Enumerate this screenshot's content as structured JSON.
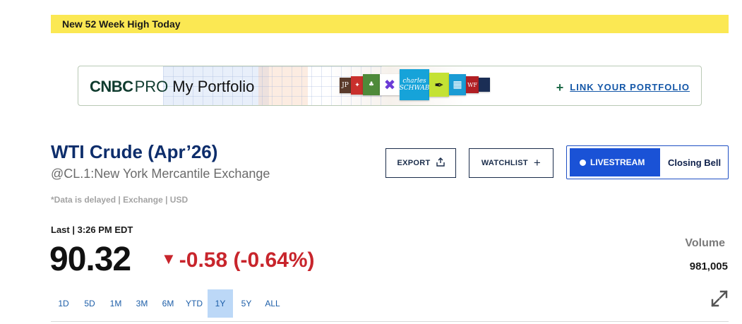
{
  "alert": {
    "text": "New 52 Week High Today"
  },
  "pro_banner": {
    "brand": "CNBC",
    "pro": "PRO",
    "title": "My Portfolio",
    "link_label": "LINK YOUR PORTFOLIO",
    "brokers": [
      {
        "name": "JP",
        "color": "#5a3a2a"
      },
      {
        "name": "wf-red",
        "color": "#c9302c"
      },
      {
        "name": "leaf",
        "color": "#4e8a3a"
      },
      {
        "name": "x",
        "color": "#ffffff"
      },
      {
        "name": "charles SCHWAB",
        "color": "#16a3d9"
      },
      {
        "name": "pen",
        "color": "#c4e234"
      },
      {
        "name": "grid",
        "color": "#1a9bd4"
      },
      {
        "name": "WF",
        "color": "#b11f24"
      },
      {
        "name": "navy",
        "color": "#1b2e55"
      }
    ]
  },
  "quote": {
    "title": "WTI Crude (Apr’26)",
    "subtitle": "@CL.1:New York Mercantile Exchange",
    "delayed_note": "*Data is delayed | Exchange | USD",
    "last_label": "Last | 3:26 PM EDT",
    "price": "90.32",
    "change": "-0.58 (-0.64%)",
    "change_direction": "down",
    "volume_label": "Volume",
    "volume_value": "981,005"
  },
  "actions": {
    "export_label": "EXPORT",
    "watchlist_label": "WATCHLIST",
    "livestream_label": "LIVESTREAM",
    "livestream_show": "Closing Bell"
  },
  "ranges": {
    "items": [
      "1D",
      "5D",
      "1M",
      "3M",
      "6M",
      "YTD",
      "1Y",
      "5Y",
      "ALL"
    ],
    "active": "1Y"
  },
  "colors": {
    "alert_bg": "#fbe853",
    "title": "#0d2d6b",
    "negative": "#c8252c",
    "link": "#1457a8",
    "live": "#1a52d6",
    "range_active": "#bcd8f7"
  }
}
